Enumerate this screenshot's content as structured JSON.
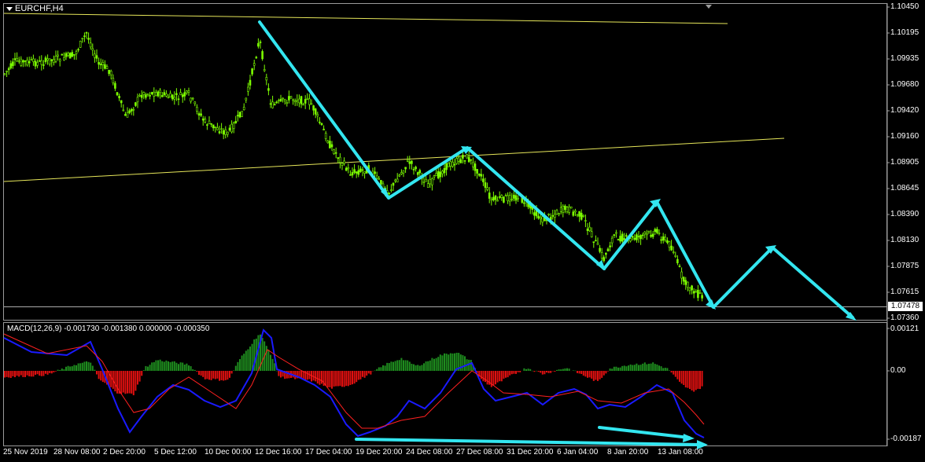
{
  "window": {
    "symbol_label": "EURCHF,H4"
  },
  "price_axis": {
    "labels": [
      "1.10450",
      "1.10195",
      "1.09935",
      "1.09680",
      "1.09420",
      "1.09160",
      "1.08905",
      "1.08645",
      "1.08390",
      "1.08130",
      "1.07875",
      "1.07615",
      "1.07360"
    ],
    "current_price": "1.07478"
  },
  "macd_panel": {
    "title": "MACD(12,26,9) -0.001730 -0.001380 0.000000 -0.000350",
    "axis_labels": [
      "0.00121",
      "0.00",
      "-0.00187"
    ]
  },
  "time_axis": {
    "labels": [
      "25 Nov 2019",
      "28 Nov 08:00",
      "2 Dec 20:00",
      "5 Dec 12:00",
      "10 Dec 00:00",
      "12 Dec 16:00",
      "17 Dec 04:00",
      "19 Dec 20:00",
      "24 Dec 08:00",
      "27 Dec 08:00",
      "31 Dec 20:00",
      "6 Jan 04:00",
      "8 Jan 20:00",
      "13 Jan 08:00"
    ]
  },
  "colors": {
    "background": "#000000",
    "candle": "#7CFC00",
    "trendline": "#E6E65A",
    "annotation": "#33E6F0",
    "macd_main": "#1A1AFF",
    "macd_signal": "#FF2020",
    "hist_up": "#1E8C1E",
    "hist_down": "#E01010"
  }
}
